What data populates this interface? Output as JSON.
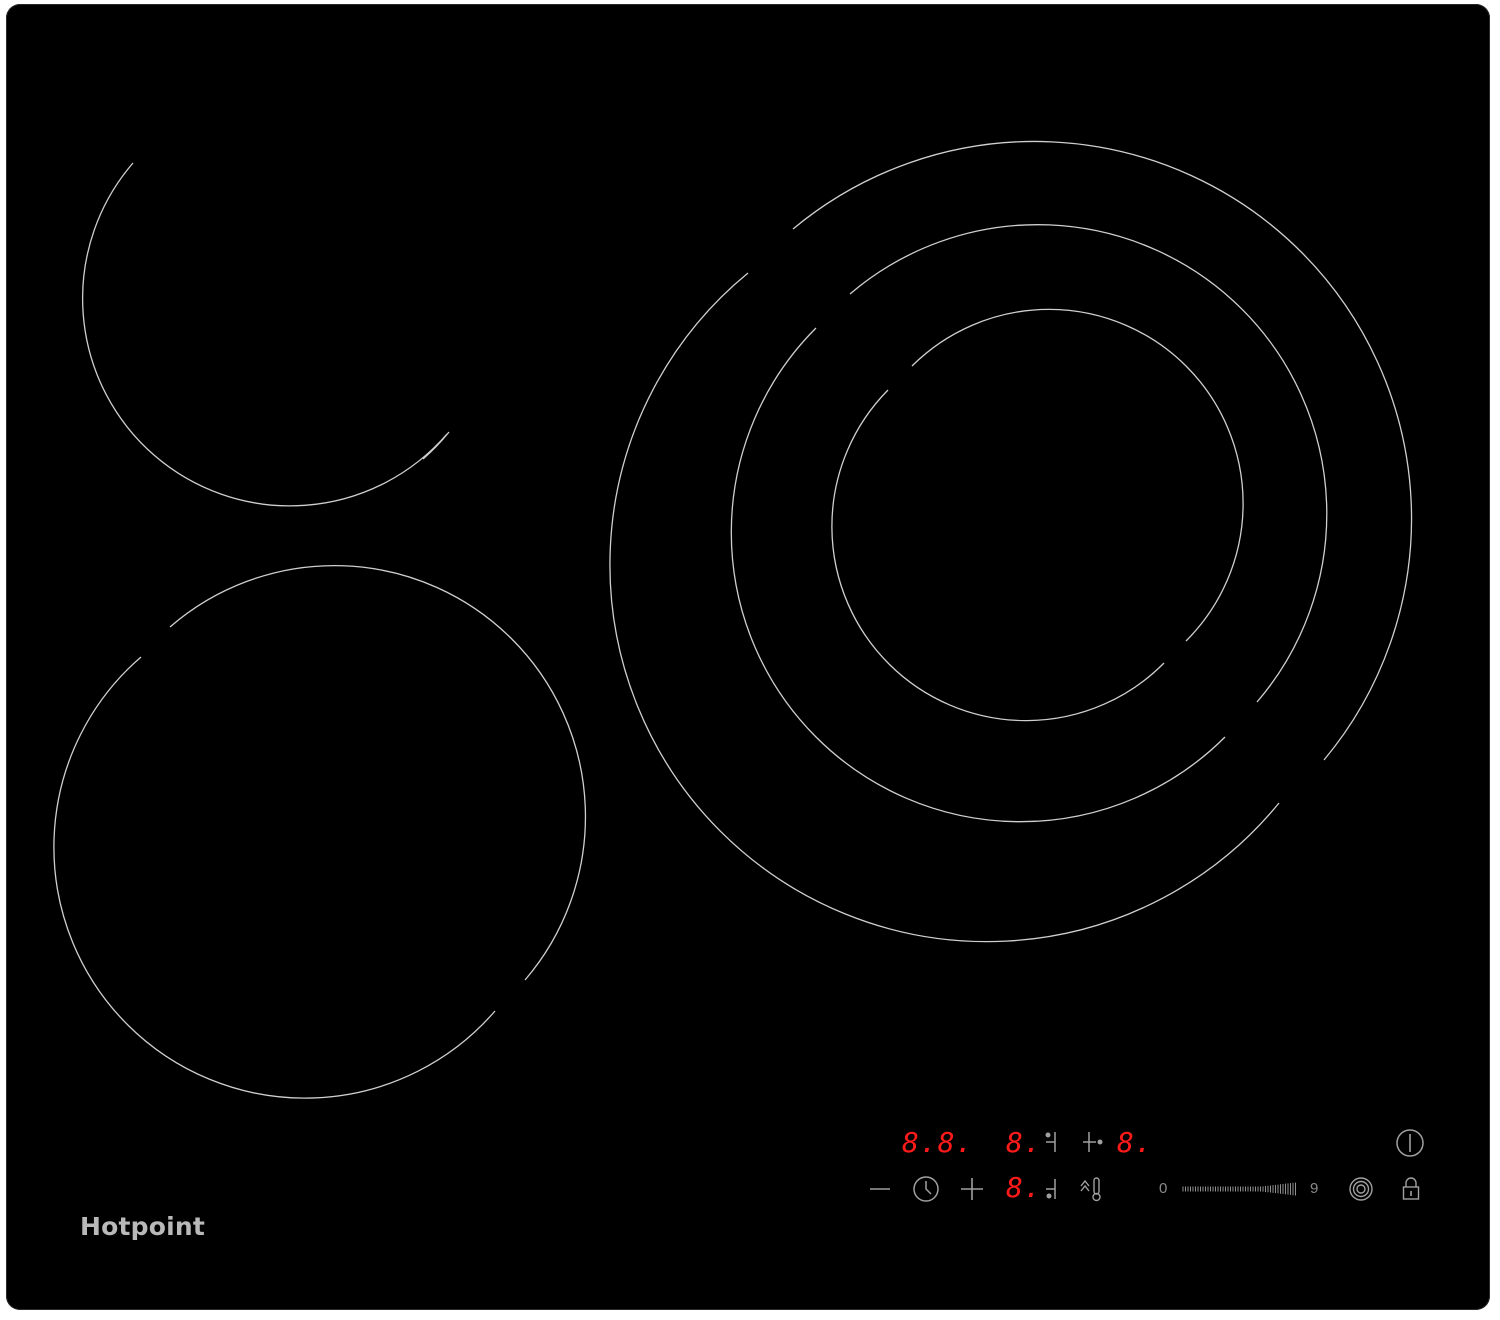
{
  "brand": {
    "name": "Hotpoint"
  },
  "displays": {
    "timer": "8.8.",
    "zone_rear_center": "8.",
    "zone_rear_right": "8.",
    "zone_front": "8."
  },
  "slider": {
    "min_label": "0",
    "max_label": "9"
  },
  "controls": {
    "icons": [
      "power-icon",
      "minus-icon",
      "clock-icon",
      "plus-icon",
      "zone-select-icon",
      "keep-warm-icon",
      "booster-icon",
      "lock-icon"
    ]
  },
  "colors": {
    "glass": "#000000",
    "display": "#ff1a1a",
    "ring": "#cfcfcf",
    "brand": "#b9b9b9"
  }
}
